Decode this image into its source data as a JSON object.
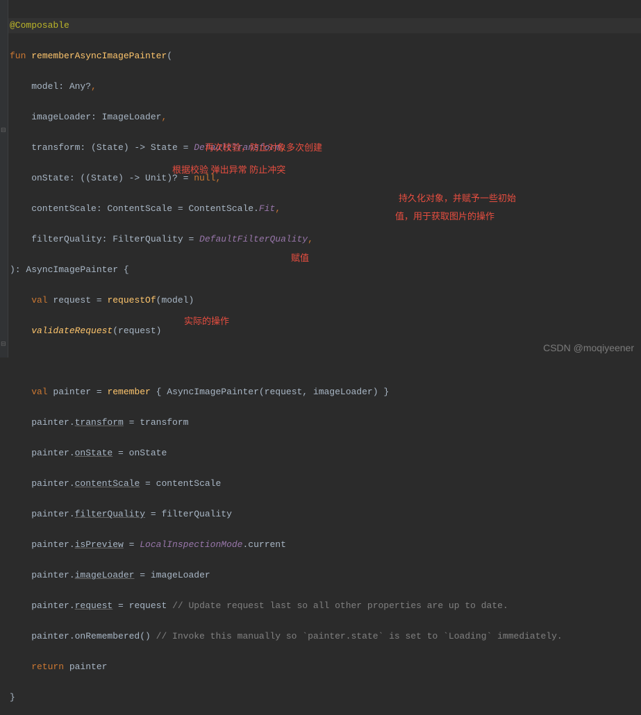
{
  "colors": {
    "accent": "#ffc66d",
    "keyword": "#cc7832",
    "annotation": "#bbb529",
    "comment": "#808080",
    "note": "#e84e40"
  },
  "gutter_icons": {
    "fold_top": "⊟",
    "fold_bottom": "⊟",
    "fold_body": "⊟"
  },
  "code": {
    "l1_annotation": "@Composable",
    "l2_fun": "fun",
    "l2_name": "rememberAsyncImagePainter",
    "l2_paren": "(",
    "l3": "    model: Any?",
    "l3_comma": ",",
    "l4": "    imageLoader: ImageLoader",
    "l4_comma": ",",
    "l5_a": "    transform: (State) -> State = ",
    "l5_b": "DefaultTransform",
    "l5_comma": ",",
    "l6_a": "    onState: ((State) -> Unit)? = ",
    "l6_null": "null",
    "l6_comma": ",",
    "l7_a": "    contentScale: ContentScale = ContentScale.",
    "l7_fit": "Fit",
    "l7_comma": ",",
    "l8_a": "    filterQuality: FilterQuality = ",
    "l8_b": "DefaultFilterQuality",
    "l8_comma": ",",
    "l9": "): AsyncImagePainter {",
    "l10_val": "    val",
    "l10_name": " request = ",
    "l10_call": "requestOf",
    "l10_args": "(model)",
    "l11_a": "    ",
    "l11_call": "validateRequest",
    "l11_args": "(request)",
    "l12": "",
    "l13_val": "    val",
    "l13_name": " painter = ",
    "l13_call": "remember",
    "l13_args": " { AsyncImagePainter(request, imageLoader) }",
    "l14_a": "    painter.",
    "l14_prop": "transform",
    "l14_b": " = transform",
    "l15_a": "    painter.",
    "l15_prop": "onState",
    "l15_b": " = onState",
    "l16_a": "    painter.",
    "l16_prop": "contentScale",
    "l16_b": " = contentScale",
    "l17_a": "    painter.",
    "l17_prop": "filterQuality",
    "l17_b": " = filterQuality",
    "l18_a": "    painter.",
    "l18_prop": "isPreview",
    "l18_b": " = ",
    "l18_c": "LocalInspectionMode",
    "l18_d": ".current",
    "l19_a": "    painter.",
    "l19_prop": "imageLoader",
    "l19_b": " = imageLoader",
    "l20_a": "    painter.",
    "l20_prop": "request",
    "l20_b": " = request ",
    "l20_comment": "// Update request last so all other properties are up to date.",
    "l21_a": "    painter.onRemembered() ",
    "l21_comment": "// Invoke this manually so `painter.state` is set to `Loading` immediately.",
    "l22_ret": "    return",
    "l22_b": " painter",
    "l23": "}"
  },
  "notes": {
    "n1": "再次校验，防止对象多次创建",
    "n2": "根据校验 弹出异常 防止冲突",
    "n3": "持久化对象，并赋予一些初始",
    "n4": "值，用于获取图片的操作",
    "n5": "赋值",
    "n6": "实际的操作"
  },
  "watermark": "CSDN @moqiyeener"
}
